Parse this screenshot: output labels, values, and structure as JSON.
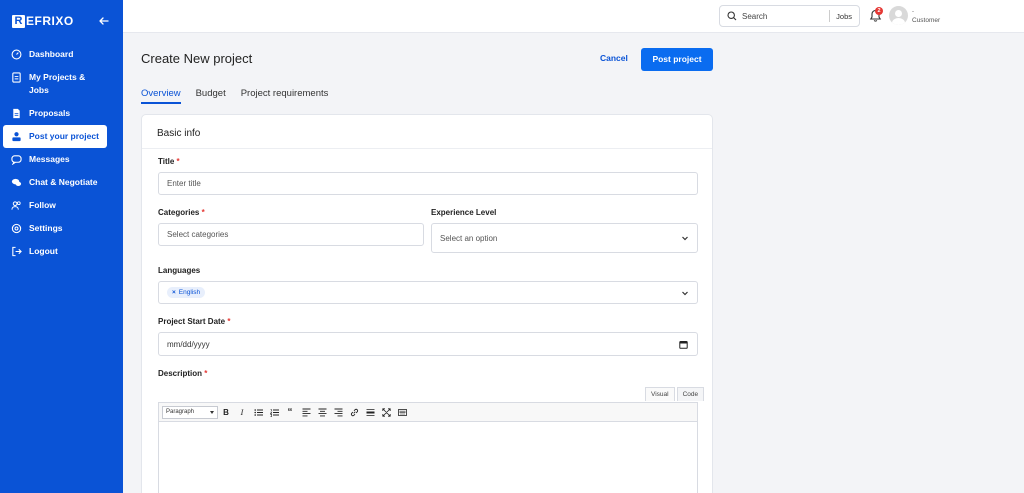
{
  "brand": {
    "name": "EFRIXO",
    "mark": "R"
  },
  "sidebar": {
    "items": [
      {
        "label": "Dashboard",
        "icon": "dashboard-icon"
      },
      {
        "label": "My Projects & Jobs",
        "icon": "document-icon"
      },
      {
        "label": "Proposals",
        "icon": "file-icon"
      },
      {
        "label": "Post your project",
        "icon": "post-project-icon",
        "active": true
      },
      {
        "label": "Messages",
        "icon": "message-icon"
      },
      {
        "label": "Chat & Negotiate",
        "icon": "chat-icon"
      },
      {
        "label": "Follow",
        "icon": "users-icon"
      },
      {
        "label": "Settings",
        "icon": "gear-icon"
      },
      {
        "label": "Logout",
        "icon": "logout-icon"
      }
    ]
  },
  "topbar": {
    "search_label": "Search",
    "search_scope": "Jobs",
    "notification_count": "2",
    "user_name": "-",
    "user_role": "Customer"
  },
  "header": {
    "title": "Create New project",
    "cancel_label": "Cancel",
    "post_label": "Post project"
  },
  "tabs": [
    {
      "label": "Overview",
      "active": true
    },
    {
      "label": "Budget"
    },
    {
      "label": "Project requirements"
    }
  ],
  "form": {
    "section_title": "Basic info",
    "title_label": "Title",
    "title_placeholder": "Enter title",
    "categories_label": "Categories",
    "categories_placeholder": "Select categories",
    "experience_label": "Experience Level",
    "experience_placeholder": "Select an option",
    "languages_label": "Languages",
    "language_chip": "English",
    "start_date_label": "Project Start Date",
    "start_date_placeholder": "mm/dd/yyyy",
    "description_label": "Description",
    "required_mark": "*"
  },
  "editor": {
    "visual_tab": "Visual",
    "code_tab": "Code",
    "format_select": "Paragraph",
    "tools": [
      "bold",
      "italic",
      "bullet-list",
      "numbered-list",
      "blockquote",
      "align-left",
      "align-center",
      "align-right",
      "link",
      "horizontal-rule",
      "fullscreen",
      "toolbar-toggle"
    ]
  },
  "colors": {
    "primary": "#0a53d6",
    "button": "#0a6cf0",
    "required": "#e53935",
    "background": "#f3f4f7"
  }
}
